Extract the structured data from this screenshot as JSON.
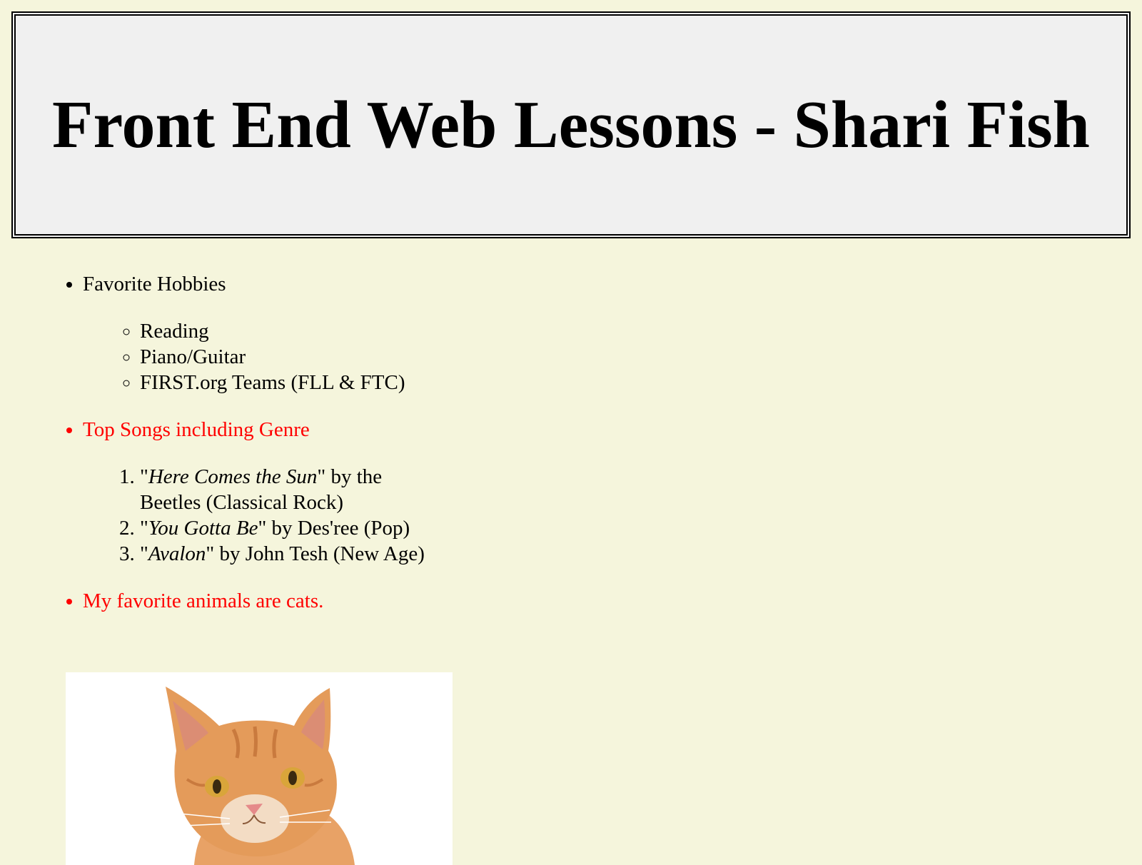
{
  "header": {
    "title": "Front End Web Lessons - Shari Fish"
  },
  "hobbies": {
    "label": "Favorite Hobbies",
    "items": [
      "Reading",
      "Piano/Guitar",
      "FIRST.org Teams (FLL & FTC)"
    ]
  },
  "songs": {
    "label": "Top Songs including Genre",
    "items": [
      {
        "open": "\"",
        "title": "Here Comes the Sun",
        "rest": "\" by the Beetles (Classical Rock)"
      },
      {
        "open": "\"",
        "title": "You Gotta Be",
        "rest": "\" by Des'ree (Pop)"
      },
      {
        "open": "\"",
        "title": "Avalon",
        "rest": "\" by John Tesh (New Age)"
      }
    ]
  },
  "animals": {
    "label": "My favorite animals are cats."
  },
  "image": {
    "subject": "orange-tabby-kitten",
    "background": "#ffffff"
  },
  "colors": {
    "page_bg": "#f5f5dc",
    "header_bg": "#f0f0f0",
    "accent_red": "#ff0000"
  }
}
